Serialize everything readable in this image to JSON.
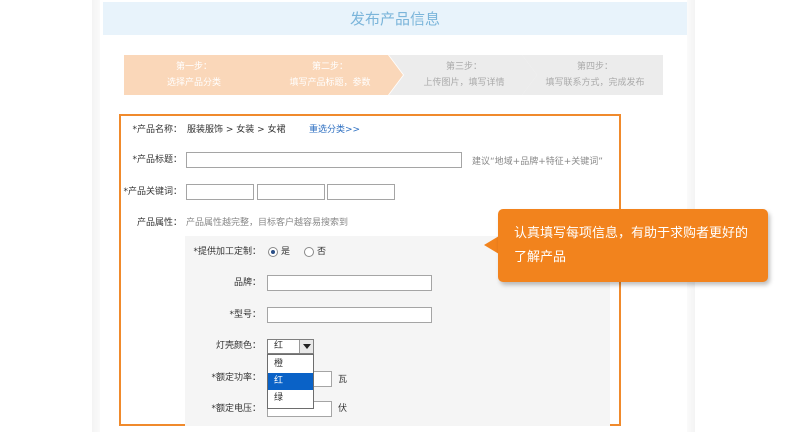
{
  "page": {
    "title": "发布产品信息"
  },
  "steps": [
    {
      "line1": "第一步：",
      "line2": "选择产品分类",
      "status": "active"
    },
    {
      "line1": "第二步：",
      "line2": "填写产品标题，参数",
      "status": "active"
    },
    {
      "line1": "第三步：",
      "line2": "上传图片，填写详情",
      "status": "inactive"
    },
    {
      "line1": "第四步：",
      "line2": "填写联系方式，完成发布",
      "status": "inactive"
    }
  ],
  "colors": {
    "step_active": "#fad7b9",
    "step_inactive": "#ececec",
    "accent": "#f08a2c",
    "tooltip": "#f2831d",
    "link": "#2d6fc1",
    "selected_option": "#0a62c7"
  },
  "form": {
    "product_name_label": "*产品名称：",
    "product_name_path": "服装服饰 > 女装 > 女裙",
    "reselect_link": "重选分类>>",
    "title_label": "*产品标题：",
    "title_value": "",
    "title_hint": "建议“地域+品牌+特征+关键词”",
    "keywords_label": "*产品关键词：",
    "keywords": [
      "",
      "",
      ""
    ],
    "attributes_label": "产品属性：",
    "attributes_hint": "产品属性越完整，目标客户越容易搜索到",
    "custom_label": "*提供加工定制：",
    "custom_options": [
      "是",
      "否"
    ],
    "custom_selected": "是",
    "brand_label": "品牌：",
    "brand_value": "",
    "model_label": "*型号：",
    "model_value": "",
    "color_label": "灯壳颜色：",
    "color_selected": "红",
    "color_options": [
      "橙",
      "红",
      "绿"
    ],
    "power_label": "*额定功率：",
    "power_unit": "瓦",
    "voltage_label": "*额定电压：",
    "voltage_unit": "伏"
  },
  "tooltip": {
    "text": "认真填写每项信息，有助于求购者更好的了解产品"
  }
}
